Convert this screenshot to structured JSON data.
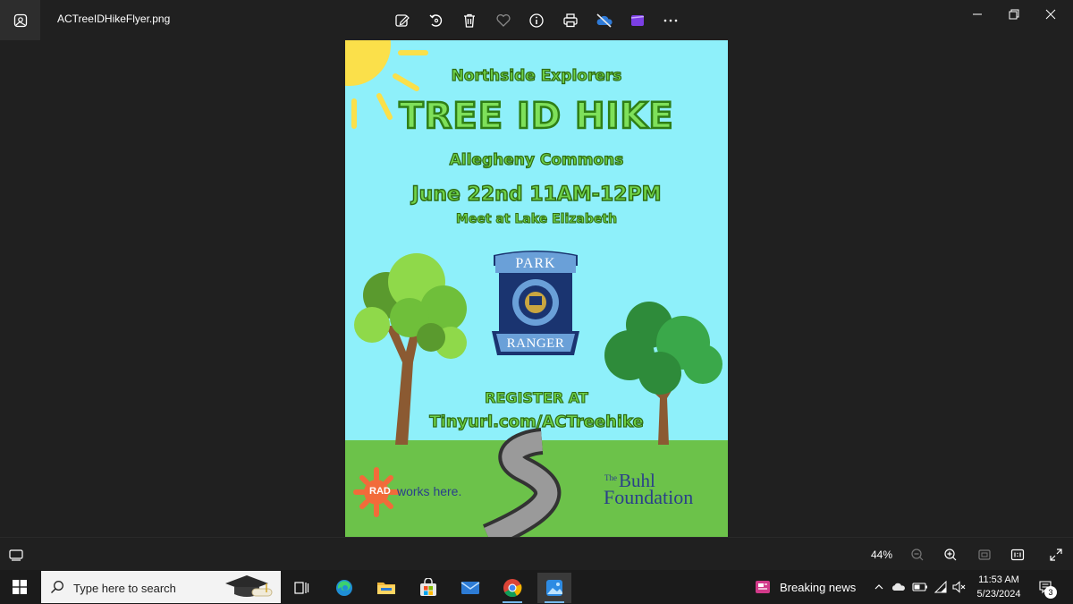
{
  "window": {
    "file_name": "ACTreeIDHikeFlyer.png"
  },
  "toolbar": {
    "items": [
      "edit-image-icon",
      "rotate-icon",
      "delete-icon",
      "favorite-icon",
      "info-icon",
      "print-icon",
      "onedrive-icon",
      "clipchamp-icon",
      "more-icon"
    ]
  },
  "window_controls": [
    "minimize-icon",
    "restore-icon",
    "close-icon"
  ],
  "flyer": {
    "org": "Northside Explorers",
    "title": "TREE ID HIKE",
    "location": "Allegheny Commons",
    "date": "June 22nd 11AM-12PM",
    "meet": "Meet at Lake Elizabeth",
    "badge_top": "PARK",
    "badge_bottom": "RANGER",
    "register": "REGISTER AT",
    "url": "Tinyurl.com/ACTreehike",
    "rad_label": "RAD",
    "rad_works": "works here.",
    "buhl_the": "The",
    "buhl_name": "Buhl",
    "buhl_foundation": "Foundation",
    "colors": {
      "sky": "#8ef0fa",
      "grass": "#6cc24a",
      "sun": "#fbe04a",
      "text_green": "#6ed24a"
    }
  },
  "viewbar": {
    "zoom": "44%"
  },
  "taskbar": {
    "search_placeholder": "Type here to search",
    "news": "Breaking news",
    "time": "11:53 AM",
    "date": "5/23/2024",
    "notifications": "3"
  }
}
